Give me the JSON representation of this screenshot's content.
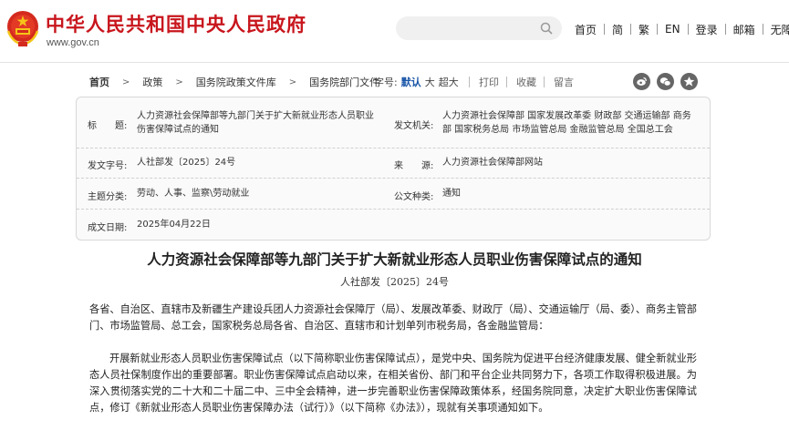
{
  "header": {
    "site_name": "中华人民共和国中央人民政府",
    "site_url": "www.gov.cn",
    "nav": [
      "首页",
      "简",
      "繁",
      "EN",
      "登录",
      "邮箱",
      "无障碍"
    ]
  },
  "breadcrumb": [
    "首页",
    "政策",
    "国务院政策文件库",
    "国务院部门文件"
  ],
  "toolbar": {
    "font_label": "字号:",
    "font_sizes": [
      "默认",
      "大",
      "超大"
    ],
    "actions": [
      "打印",
      "收藏",
      "留言"
    ],
    "share_icons": [
      "weibo-icon",
      "wechat-icon",
      "more-icon"
    ]
  },
  "info": {
    "title_label": "标　　题:",
    "title_value": "人力资源社会保障部等九部门关于扩大新就业形态人员职业伤害保障试点的通知",
    "issuer_label": "发文机关:",
    "issuer_value": "人力资源社会保障部 国家发展改革委 财政部 交通运输部 商务部 国家税务总局 市场监管总局 金融监管总局 全国总工会",
    "docno_label": "发文字号:",
    "docno_value": "人社部发〔2025〕24号",
    "source_label": "来　　源:",
    "source_value": "人力资源社会保障部网站",
    "topic_label": "主题分类:",
    "topic_value": "劳动、人事、监察\\劳动就业",
    "type_label": "公文种类:",
    "type_value": "通知",
    "date_label": "成文日期:",
    "date_value": "2025年04月22日"
  },
  "article": {
    "title": "人力资源社会保障部等九部门关于扩大新就业形态人员职业伤害保障试点的通知",
    "doc_number": "人社部发〔2025〕24号",
    "para1": "各省、自治区、直辖市及新疆生产建设兵团人力资源社会保障厅（局）、发展改革委、财政厅（局）、交通运输厅（局、委）、商务主管部门、市场监管局、总工会，国家税务总局各省、自治区、直辖市和计划单列市税务局，各金融监管局：",
    "para2": "开展新就业形态人员职业伤害保障试点（以下简称职业伤害保障试点），是党中央、国务院为促进平台经济健康发展、健全新就业形态人员社保制度作出的重要部署。职业伤害保障试点启动以来，在相关省份、部门和平台企业共同努力下，各项工作取得积极进展。为深入贯彻落实党的二十大和二十届二中、三中全会精神，进一步完善职业伤害保障政策体系，经国务院同意，决定扩大职业伤害保障试点，修订《新就业形态人员职业伤害保障办法（试行）》（以下简称《办法》），现就有关事项通知如下。"
  },
  "colors": {
    "brand_red": "#c8161d",
    "link_blue": "#1a56a8"
  }
}
